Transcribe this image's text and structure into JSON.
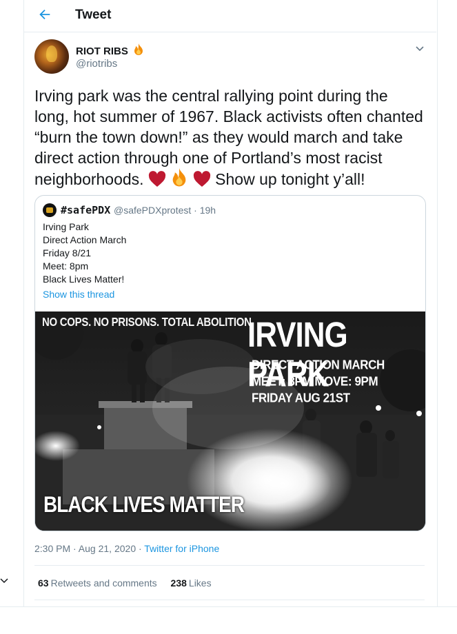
{
  "header": {
    "title": "Tweet",
    "back_icon": "arrow-left-icon"
  },
  "author": {
    "name": "RIOT RIBS",
    "handle": "@riotribs",
    "badge_icon": "fire-icon"
  },
  "tweet": {
    "line1": "Irving park was the central rallying point during the",
    "line2": "long, hot summer of 1967. Black activists often chanted",
    "line3": "“burn the town down!” as they would march and take",
    "line4": "direct action through one of Portland’s most racist",
    "line5": "neighborhoods.",
    "line5_end": "Show up tonight y’all!",
    "emojis": [
      "heart-icon",
      "fire-icon",
      "heart-icon"
    ]
  },
  "quoted": {
    "name": "#safePDX",
    "meta": "@safePDXprotest · 19h",
    "lines": [
      "Irving Park",
      "Direct Action March",
      "Friday 8/21",
      "Meet: 8pm",
      "Black Lives Matter!"
    ],
    "link": "Show this thread",
    "poster": {
      "slogan": "NO COPS. NO PRISONS. TOTAL ABOLITION.",
      "title": "IRVING PARK",
      "sub1": "DIRECT ACTION MARCH",
      "sub2": "MEET: 8PM MOVE: 9PM",
      "sub3": "FRIDAY AUG 21ST",
      "bottom": "BLACK LIVES MATTER"
    }
  },
  "meta": {
    "time": "2:30 PM · Aug 21, 2020 · ",
    "source": "Twitter for iPhone"
  },
  "stats": {
    "retweets_count": "63",
    "retweets_label": "Retweets and comments",
    "likes_count": "238",
    "likes_label": "Likes"
  },
  "colors": {
    "accent": "#1b95e0",
    "text": "#14171a",
    "muted": "#657786",
    "border": "#e6ecf0"
  }
}
